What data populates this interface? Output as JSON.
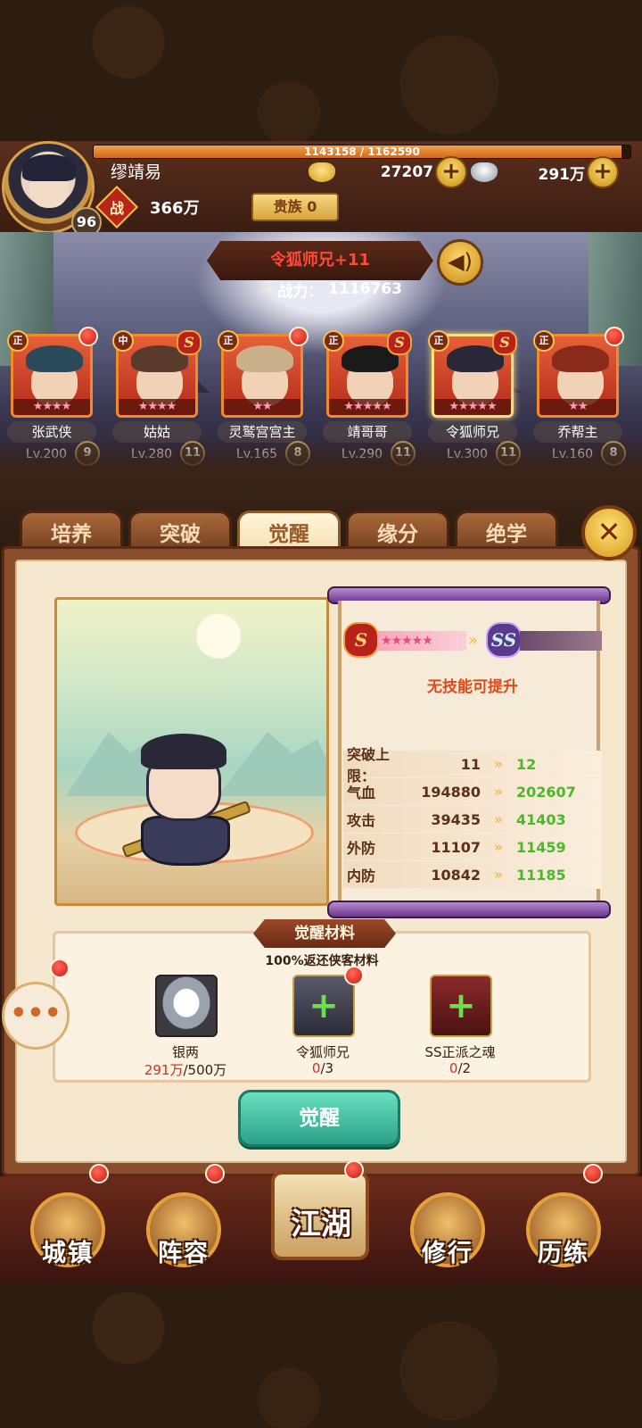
{
  "player": {
    "exp_text": "1143158 / 1162590",
    "exp_fraction": 0.983,
    "name": "缪靖易",
    "level": "96",
    "gold": "27207",
    "silver": "291万",
    "power_icon": "战",
    "power": "366万",
    "noble": "贵族 0"
  },
  "scene": {
    "hero_title": "令狐师兄+11",
    "power_label": "战力：",
    "power_value": "1116763"
  },
  "heroes": [
    {
      "name": "张武侠",
      "tag": "正",
      "stars": "★★★★",
      "level": "Lv.200",
      "break": "9",
      "hair": "#2a4a5a"
    },
    {
      "name": "姑姑",
      "tag": "中",
      "rank": "S",
      "stars": "★★★★",
      "level": "Lv.280",
      "break": "11",
      "hair": "#5a3a2a"
    },
    {
      "name": "灵鹫宫宫主",
      "tag": "正",
      "stars": "★★",
      "level": "Lv.165",
      "break": "8",
      "hair": "#c9b08a"
    },
    {
      "name": "靖哥哥",
      "tag": "正",
      "rank": "S",
      "stars": "★★★★★",
      "level": "Lv.290",
      "break": "11",
      "hair": "#1a1a1a"
    },
    {
      "name": "令狐师兄",
      "tag": "正",
      "rank": "S",
      "stars": "★★★★★",
      "level": "Lv.300",
      "break": "11",
      "hair": "#2a2838"
    },
    {
      "name": "乔帮主",
      "tag": "正",
      "stars": "★★",
      "level": "Lv.160",
      "break": "8",
      "hair": "#8a2a1a"
    }
  ],
  "tabs": [
    "培养",
    "突破",
    "觉醒",
    "缘分",
    "绝学"
  ],
  "active_tab": "觉醒",
  "awaken": {
    "rank_from": "S",
    "rank_to": "SS",
    "stars": "★★★★★",
    "no_skill": "无技能可提升",
    "stats": [
      {
        "label": "突破上限：",
        "current": "11",
        "next": "12"
      },
      {
        "label": "气血",
        "current": "194880",
        "next": "202607"
      },
      {
        "label": "攻击",
        "current": "39435",
        "next": "41403"
      },
      {
        "label": "外防",
        "current": "11107",
        "next": "11459"
      },
      {
        "label": "内防",
        "current": "10842",
        "next": "11185"
      }
    ]
  },
  "materials": {
    "title": "觉醒材料",
    "subtitle": "100%返还侠客材料",
    "items": [
      {
        "name": "银两",
        "have": "291万",
        "need": "/500万"
      },
      {
        "name": "令狐师兄",
        "have": "0",
        "need": "/3"
      },
      {
        "name": "SS正派之魂",
        "have": "0",
        "need": "/2"
      }
    ]
  },
  "awaken_button": "觉醒",
  "nav": [
    "城镇",
    "阵容",
    "江湖",
    "修行",
    "历练"
  ]
}
